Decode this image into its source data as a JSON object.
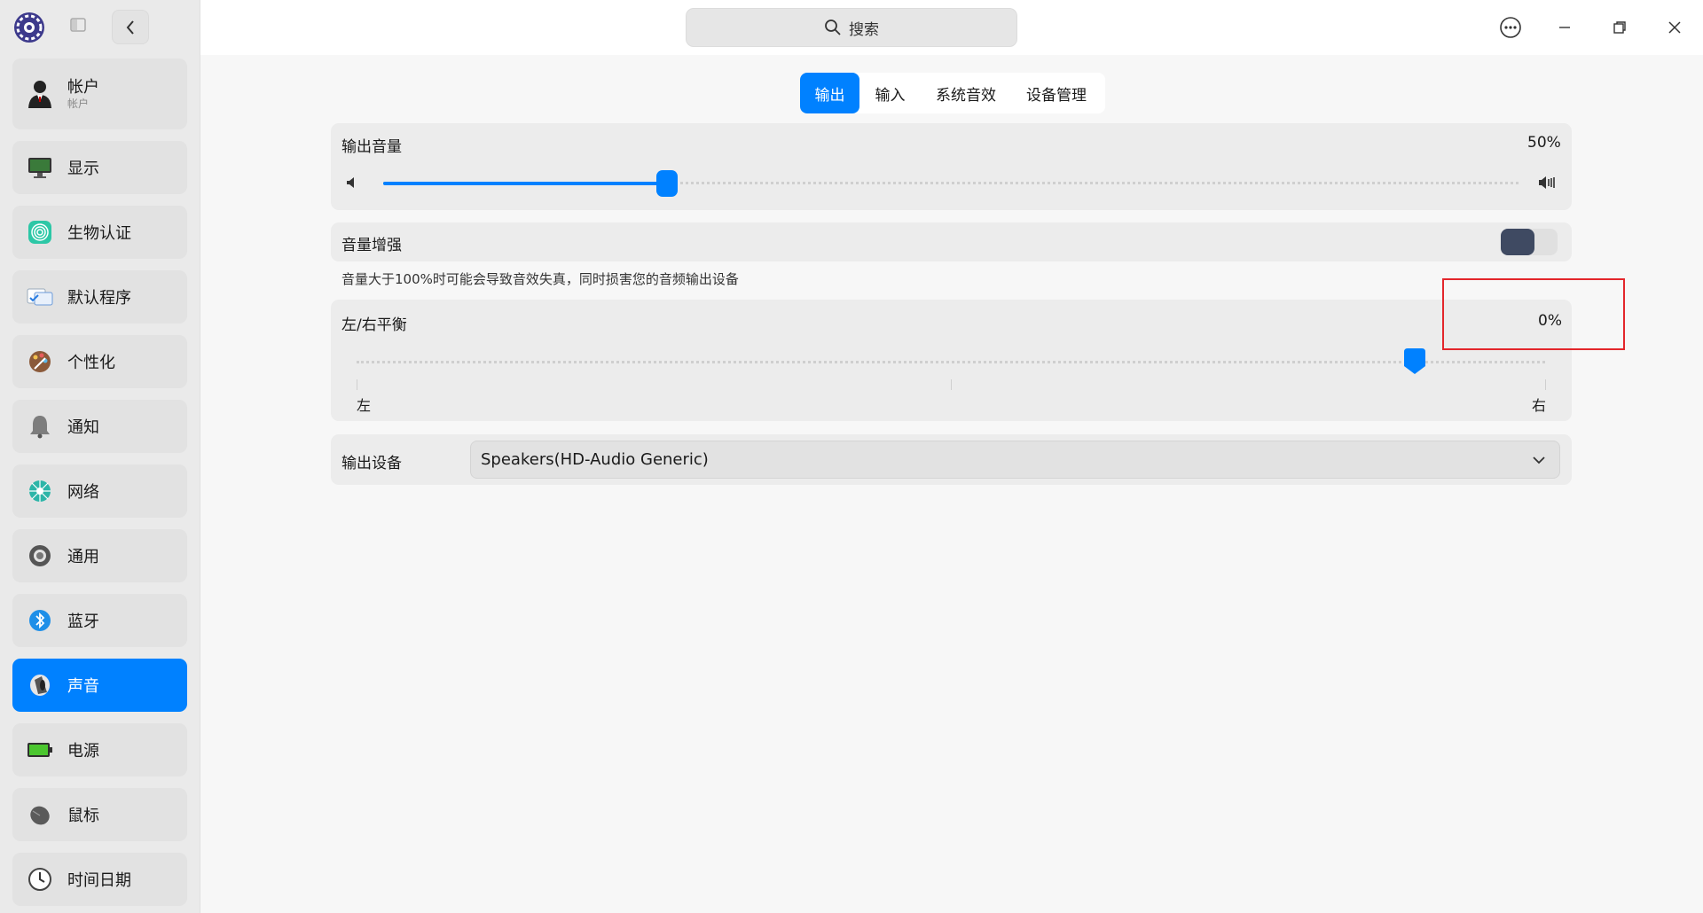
{
  "sidebar": {
    "items": [
      {
        "label": "帐户",
        "sub": "帐户",
        "icon": "user-icon"
      },
      {
        "label": "显示",
        "icon": "monitor-icon"
      },
      {
        "label": "生物认证",
        "icon": "fingerprint-icon"
      },
      {
        "label": "默认程序",
        "icon": "default-apps-icon"
      },
      {
        "label": "个性化",
        "icon": "palette-icon"
      },
      {
        "label": "通知",
        "icon": "bell-icon"
      },
      {
        "label": "网络",
        "icon": "network-icon"
      },
      {
        "label": "通用",
        "icon": "general-icon"
      },
      {
        "label": "蓝牙",
        "icon": "bluetooth-icon"
      },
      {
        "label": "声音",
        "icon": "speaker-icon",
        "active": true
      },
      {
        "label": "电源",
        "icon": "battery-icon"
      },
      {
        "label": "鼠标",
        "icon": "mouse-icon"
      },
      {
        "label": "时间日期",
        "icon": "clock-icon"
      }
    ]
  },
  "header": {
    "search_placeholder": "搜索"
  },
  "tabs": [
    {
      "label": "输出",
      "active": true
    },
    {
      "label": "输入"
    },
    {
      "label": "系统音效"
    },
    {
      "label": "设备管理"
    }
  ],
  "output_volume": {
    "label": "输出音量",
    "value_text": "50%",
    "value": 0.5
  },
  "volume_boost": {
    "label": "音量增强",
    "enabled": true,
    "note": "音量大于100%时可能会导致音效失真，同时损害您的音频输出设备"
  },
  "balance": {
    "label": "左/右平衡",
    "value_text": "0%",
    "position": 0.89,
    "left_label": "左",
    "right_label": "右"
  },
  "output_device": {
    "label": "输出设备",
    "selected": "Speakers(HD-Audio Generic)"
  },
  "colors": {
    "accent": "#0081ff",
    "highlight_box": "#e3262b"
  }
}
